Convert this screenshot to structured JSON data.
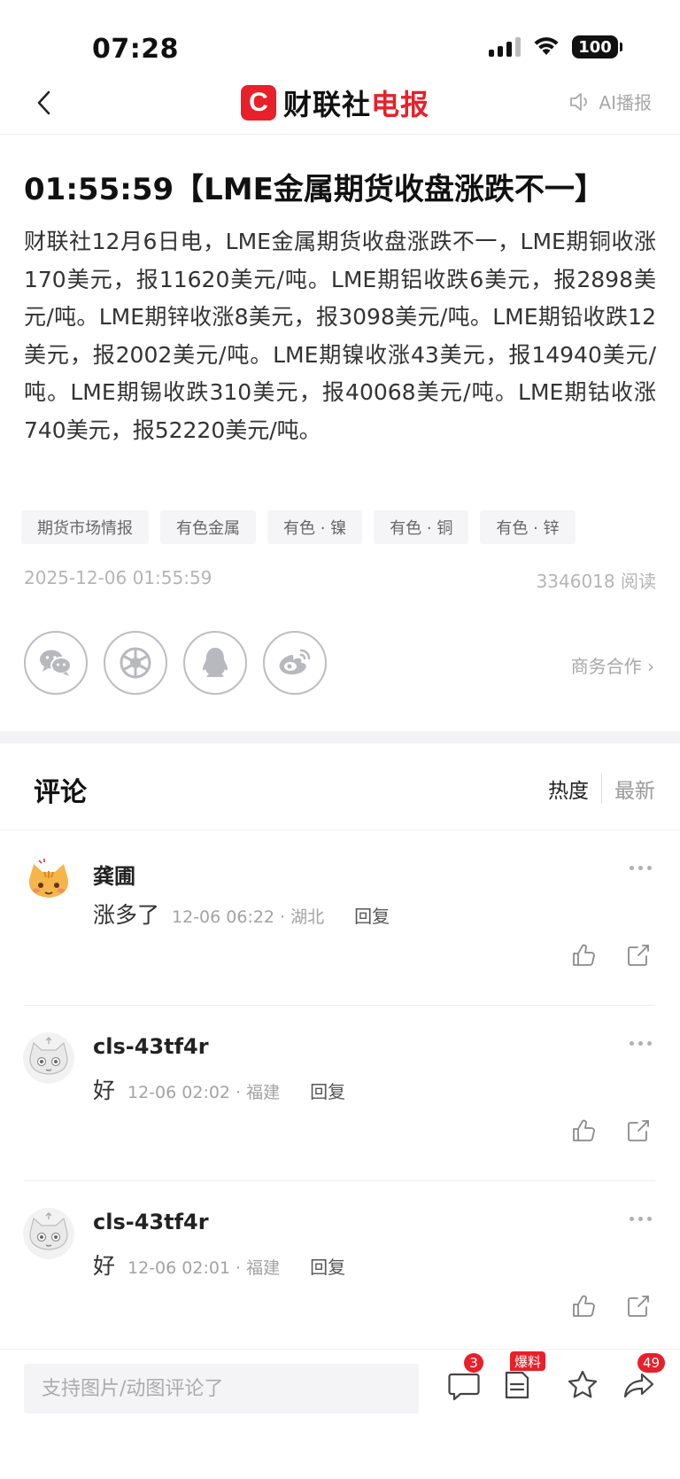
{
  "status_bar": {
    "time": "07:28",
    "battery": "100"
  },
  "nav": {
    "brand_first": "财联社",
    "brand_second": "电报",
    "ai_label": "AI播报"
  },
  "article": {
    "title": "01:55:59【LME金属期货收盘涨跌不一】",
    "body": "财联社12月6日电，LME金属期货收盘涨跌不一，LME期铜收涨170美元，报11620美元/吨。LME期铝收跌6美元，报2898美元/吨。LME期锌收涨8美元，报3098美元/吨。LME期铅收跌12美元，报2002美元/吨。LME期镍收涨43美元，报14940美元/吨。LME期锡收跌310美元，报40068美元/吨。LME期钴收涨740美元，报52220美元/吨。",
    "tags": [
      "期货市场情报",
      "有色金属",
      "有色 · 镍",
      "有色 · 铜",
      "有色 · 锌"
    ],
    "datetime": "2025-12-06 01:55:59",
    "reads": "3346018 阅读",
    "share_icons": [
      "wechat-icon",
      "moments-icon",
      "qq-icon",
      "weibo-icon"
    ],
    "biz_link": "商务合作 ›"
  },
  "comments": {
    "title": "评论",
    "sort_hot": "热度",
    "sort_new": "最新",
    "items": [
      {
        "user": "龚圃",
        "text": "涨多了",
        "time": "12-06 06:22 · 湖北",
        "reply": "回复",
        "avatar": "cat-avatar-orange"
      },
      {
        "user": "cls-43tf4r",
        "text": "好",
        "time": "12-06 02:02 · 福建",
        "reply": "回复",
        "avatar": "cat-avatar-gray"
      },
      {
        "user": "cls-43tf4r",
        "text": "好",
        "time": "12-06 02:01 · 福建",
        "reply": "回复",
        "avatar": "cat-avatar-gray"
      }
    ]
  },
  "bottom_bar": {
    "input_placeholder": "支持图片/动图评论了",
    "comment_count": "3",
    "tip_label": "爆料",
    "share_count": "49"
  },
  "colors": {
    "brand_red": "#e8202a",
    "muted": "#a8a8a8"
  }
}
